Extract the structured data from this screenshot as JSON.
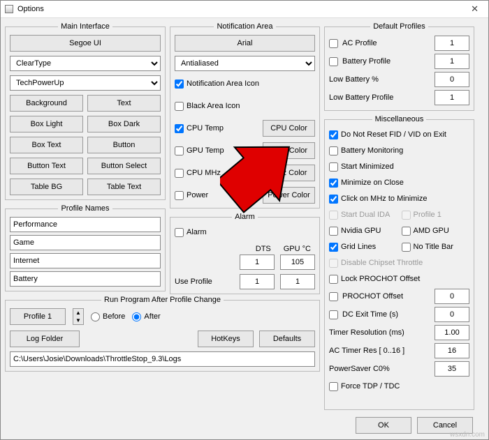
{
  "title": "Options",
  "mainInterface": {
    "legend": "Main Interface",
    "fontBtn": "Segoe UI",
    "renderSelect": "ClearType",
    "brandSelect": "TechPowerUp",
    "btns": [
      "Background",
      "Text",
      "Box Light",
      "Box Dark",
      "Box Text",
      "Button",
      "Button Text",
      "Button Select",
      "Table BG",
      "Table Text"
    ]
  },
  "profileNames": {
    "legend": "Profile Names",
    "values": [
      "Performance",
      "Game",
      "Internet",
      "Battery"
    ]
  },
  "runProgram": {
    "legend": "Run Program After Profile Change",
    "profileBtn": "Profile 1",
    "before": "Before",
    "after": "After",
    "logFolderBtn": "Log Folder",
    "path": "C:\\Users\\Josie\\Downloads\\ThrottleStop_9.3\\Logs"
  },
  "notification": {
    "legend": "Notification Area",
    "fontBtn": "Arial",
    "aaSelect": "Antialiased",
    "rows": [
      {
        "label": "Notification Area Icon",
        "checked": true,
        "btn": null
      },
      {
        "label": "Black Area Icon",
        "checked": false,
        "btn": null
      },
      {
        "label": "CPU Temp",
        "checked": true,
        "btn": "CPU Color"
      },
      {
        "label": "GPU Temp",
        "checked": false,
        "btn": "GPU Color"
      },
      {
        "label": "CPU MHz",
        "checked": false,
        "btn": "MHz Color"
      },
      {
        "label": "Power",
        "checked": false,
        "btn": "Power Color"
      }
    ]
  },
  "alarm": {
    "legend": "Alarm",
    "cb": "Alarm",
    "dts": "DTS",
    "gpu": "GPU °C",
    "dtsVal": "1",
    "gpuVal": "105",
    "useProfile": "Use Profile",
    "up1": "1",
    "up2": "1"
  },
  "midBtns": {
    "hotkeys": "HotKeys",
    "defaults": "Defaults"
  },
  "defaultProfiles": {
    "legend": "Default Profiles",
    "rows": [
      {
        "label": "AC Profile",
        "cb": true,
        "val": "1",
        "checked": false
      },
      {
        "label": "Battery Profile",
        "cb": true,
        "val": "1",
        "checked": false
      },
      {
        "label": "Low Battery %",
        "cb": false,
        "val": "0"
      },
      {
        "label": "Low Battery Profile",
        "cb": false,
        "val": "1"
      }
    ]
  },
  "misc": {
    "legend": "Miscellaneous",
    "items": [
      {
        "label": "Do Not Reset FID / VID on Exit",
        "checked": true
      },
      {
        "label": "Battery Monitoring",
        "checked": false
      },
      {
        "label": "Start Minimized",
        "checked": false
      },
      {
        "label": "Minimize on Close",
        "checked": true
      },
      {
        "label": "Click on MHz to Minimize",
        "checked": true
      }
    ],
    "dual": [
      {
        "label": "Start Dual IDA",
        "checked": false,
        "dim": true
      },
      {
        "label": "Profile 1",
        "checked": false,
        "dim": true
      }
    ],
    "gpu": [
      {
        "label": "Nvidia GPU",
        "checked": false
      },
      {
        "label": "AMD GPU",
        "checked": false
      }
    ],
    "grid": [
      {
        "label": "Grid Lines",
        "checked": true
      },
      {
        "label": "No Title Bar",
        "checked": false
      }
    ],
    "chipset": {
      "label": "Disable Chipset Throttle",
      "checked": false,
      "dim": true
    },
    "lock": {
      "label": "Lock PROCHOT Offset",
      "checked": false
    },
    "numrows": [
      {
        "label": "PROCHOT Offset",
        "cb": true,
        "val": "0",
        "checked": false
      },
      {
        "label": "DC Exit Time (s)",
        "cb": true,
        "val": "0",
        "checked": false
      },
      {
        "label": "Timer Resolution (ms)",
        "cb": false,
        "val": "1.00"
      },
      {
        "label": "AC Timer Res [ 0..16 ]",
        "cb": false,
        "val": "16"
      },
      {
        "label": "PowerSaver C0%",
        "cb": false,
        "val": "35"
      }
    ],
    "force": {
      "label": "Force TDP / TDC",
      "checked": false
    }
  },
  "actions": {
    "ok": "OK",
    "cancel": "Cancel"
  },
  "watermark": "wsxdn.com"
}
